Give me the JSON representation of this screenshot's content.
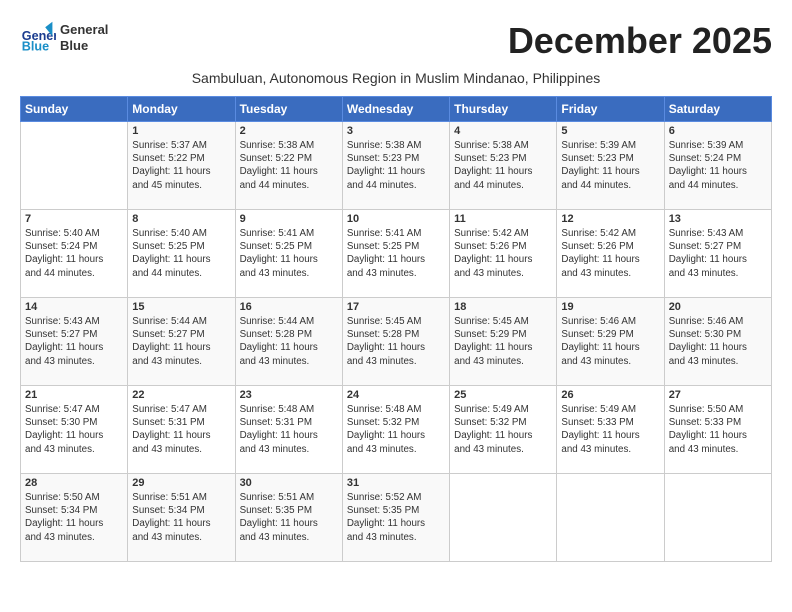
{
  "logo": {
    "line1": "General",
    "line2": "Blue"
  },
  "title": "December 2025",
  "subtitle": "Sambuluan, Autonomous Region in Muslim Mindanao, Philippines",
  "days_header": [
    "Sunday",
    "Monday",
    "Tuesday",
    "Wednesday",
    "Thursday",
    "Friday",
    "Saturday"
  ],
  "weeks": [
    [
      {
        "day": "",
        "info": ""
      },
      {
        "day": "1",
        "info": "Sunrise: 5:37 AM\nSunset: 5:22 PM\nDaylight: 11 hours\nand 45 minutes."
      },
      {
        "day": "2",
        "info": "Sunrise: 5:38 AM\nSunset: 5:22 PM\nDaylight: 11 hours\nand 44 minutes."
      },
      {
        "day": "3",
        "info": "Sunrise: 5:38 AM\nSunset: 5:23 PM\nDaylight: 11 hours\nand 44 minutes."
      },
      {
        "day": "4",
        "info": "Sunrise: 5:38 AM\nSunset: 5:23 PM\nDaylight: 11 hours\nand 44 minutes."
      },
      {
        "day": "5",
        "info": "Sunrise: 5:39 AM\nSunset: 5:23 PM\nDaylight: 11 hours\nand 44 minutes."
      },
      {
        "day": "6",
        "info": "Sunrise: 5:39 AM\nSunset: 5:24 PM\nDaylight: 11 hours\nand 44 minutes."
      }
    ],
    [
      {
        "day": "7",
        "info": "Sunrise: 5:40 AM\nSunset: 5:24 PM\nDaylight: 11 hours\nand 44 minutes."
      },
      {
        "day": "8",
        "info": "Sunrise: 5:40 AM\nSunset: 5:25 PM\nDaylight: 11 hours\nand 44 minutes."
      },
      {
        "day": "9",
        "info": "Sunrise: 5:41 AM\nSunset: 5:25 PM\nDaylight: 11 hours\nand 43 minutes."
      },
      {
        "day": "10",
        "info": "Sunrise: 5:41 AM\nSunset: 5:25 PM\nDaylight: 11 hours\nand 43 minutes."
      },
      {
        "day": "11",
        "info": "Sunrise: 5:42 AM\nSunset: 5:26 PM\nDaylight: 11 hours\nand 43 minutes."
      },
      {
        "day": "12",
        "info": "Sunrise: 5:42 AM\nSunset: 5:26 PM\nDaylight: 11 hours\nand 43 minutes."
      },
      {
        "day": "13",
        "info": "Sunrise: 5:43 AM\nSunset: 5:27 PM\nDaylight: 11 hours\nand 43 minutes."
      }
    ],
    [
      {
        "day": "14",
        "info": "Sunrise: 5:43 AM\nSunset: 5:27 PM\nDaylight: 11 hours\nand 43 minutes."
      },
      {
        "day": "15",
        "info": "Sunrise: 5:44 AM\nSunset: 5:27 PM\nDaylight: 11 hours\nand 43 minutes."
      },
      {
        "day": "16",
        "info": "Sunrise: 5:44 AM\nSunset: 5:28 PM\nDaylight: 11 hours\nand 43 minutes."
      },
      {
        "day": "17",
        "info": "Sunrise: 5:45 AM\nSunset: 5:28 PM\nDaylight: 11 hours\nand 43 minutes."
      },
      {
        "day": "18",
        "info": "Sunrise: 5:45 AM\nSunset: 5:29 PM\nDaylight: 11 hours\nand 43 minutes."
      },
      {
        "day": "19",
        "info": "Sunrise: 5:46 AM\nSunset: 5:29 PM\nDaylight: 11 hours\nand 43 minutes."
      },
      {
        "day": "20",
        "info": "Sunrise: 5:46 AM\nSunset: 5:30 PM\nDaylight: 11 hours\nand 43 minutes."
      }
    ],
    [
      {
        "day": "21",
        "info": "Sunrise: 5:47 AM\nSunset: 5:30 PM\nDaylight: 11 hours\nand 43 minutes."
      },
      {
        "day": "22",
        "info": "Sunrise: 5:47 AM\nSunset: 5:31 PM\nDaylight: 11 hours\nand 43 minutes."
      },
      {
        "day": "23",
        "info": "Sunrise: 5:48 AM\nSunset: 5:31 PM\nDaylight: 11 hours\nand 43 minutes."
      },
      {
        "day": "24",
        "info": "Sunrise: 5:48 AM\nSunset: 5:32 PM\nDaylight: 11 hours\nand 43 minutes."
      },
      {
        "day": "25",
        "info": "Sunrise: 5:49 AM\nSunset: 5:32 PM\nDaylight: 11 hours\nand 43 minutes."
      },
      {
        "day": "26",
        "info": "Sunrise: 5:49 AM\nSunset: 5:33 PM\nDaylight: 11 hours\nand 43 minutes."
      },
      {
        "day": "27",
        "info": "Sunrise: 5:50 AM\nSunset: 5:33 PM\nDaylight: 11 hours\nand 43 minutes."
      }
    ],
    [
      {
        "day": "28",
        "info": "Sunrise: 5:50 AM\nSunset: 5:34 PM\nDaylight: 11 hours\nand 43 minutes."
      },
      {
        "day": "29",
        "info": "Sunrise: 5:51 AM\nSunset: 5:34 PM\nDaylight: 11 hours\nand 43 minutes."
      },
      {
        "day": "30",
        "info": "Sunrise: 5:51 AM\nSunset: 5:35 PM\nDaylight: 11 hours\nand 43 minutes."
      },
      {
        "day": "31",
        "info": "Sunrise: 5:52 AM\nSunset: 5:35 PM\nDaylight: 11 hours\nand 43 minutes."
      },
      {
        "day": "",
        "info": ""
      },
      {
        "day": "",
        "info": ""
      },
      {
        "day": "",
        "info": ""
      }
    ]
  ]
}
